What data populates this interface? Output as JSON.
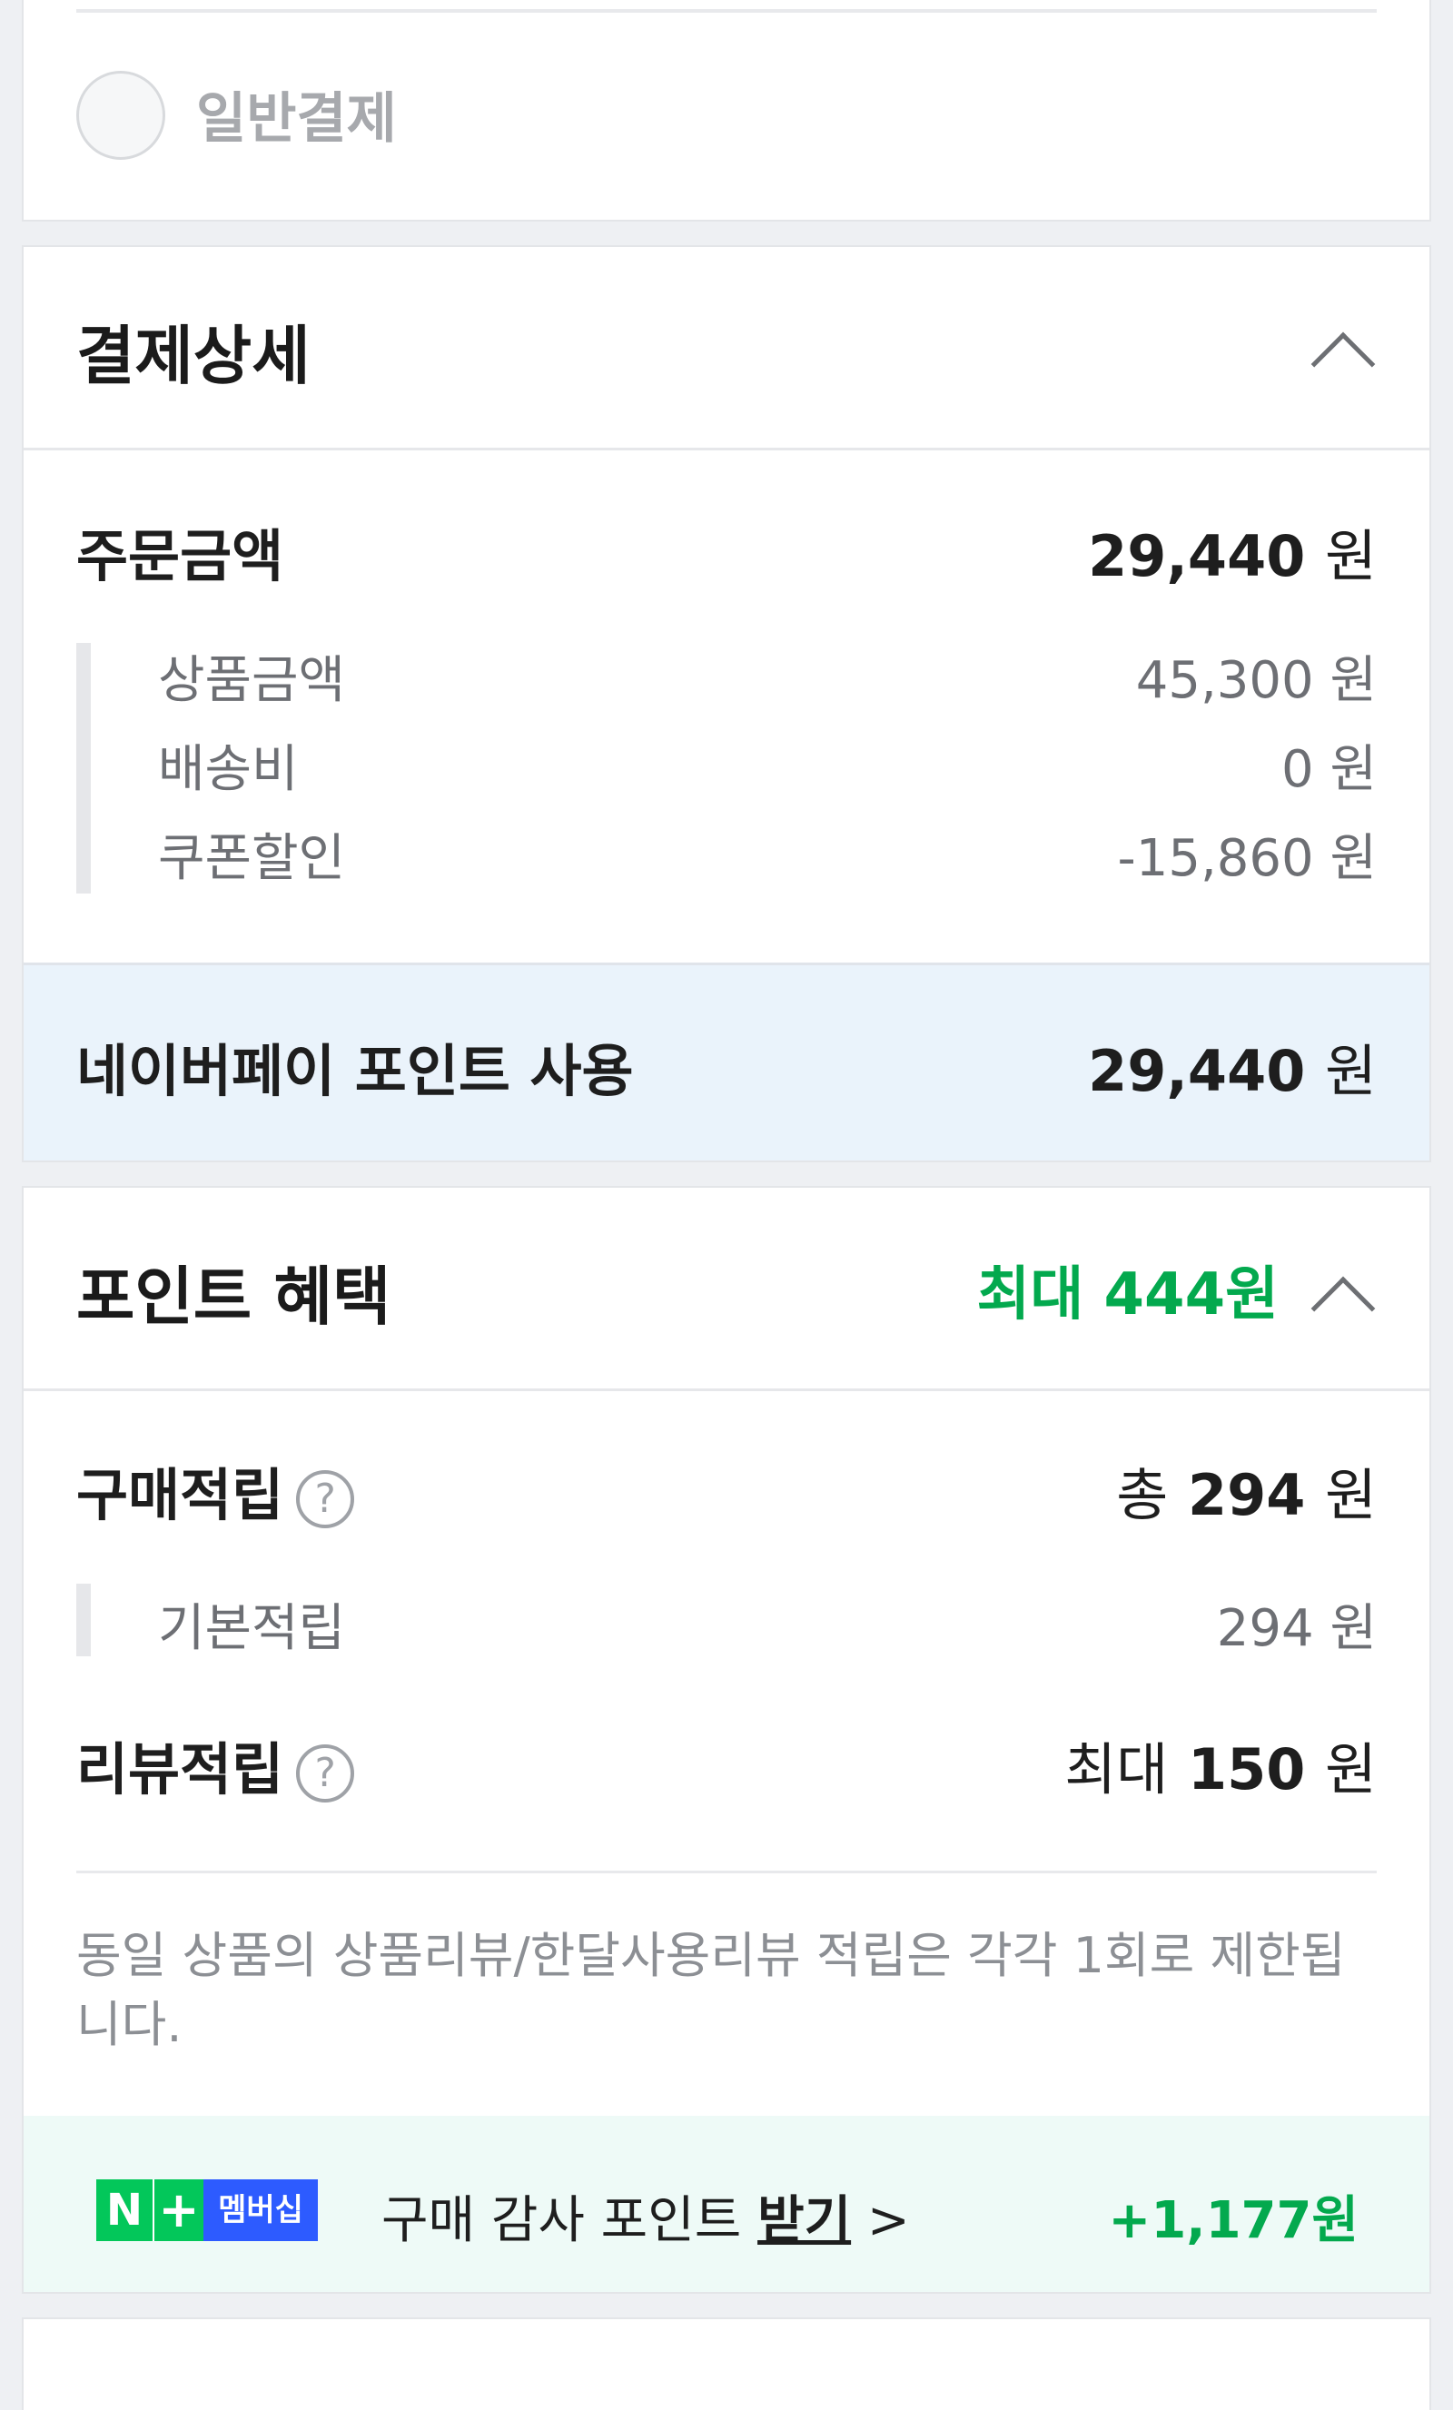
{
  "payment_method": {
    "label": "일반결제"
  },
  "payment_detail": {
    "title": "결제상세",
    "order_amount": {
      "label": "주문금액",
      "value": "29,440",
      "unit": "원"
    },
    "breakdown": [
      {
        "label": "상품금액",
        "value": "45,300",
        "unit": "원"
      },
      {
        "label": "배송비",
        "value": "0",
        "unit": "원"
      },
      {
        "label": "쿠폰할인",
        "value": "-15,860",
        "unit": "원"
      }
    ],
    "point_use": {
      "label": "네이버페이 포인트 사용",
      "value": "29,440",
      "unit": "원"
    }
  },
  "point_benefit": {
    "title": "포인트 혜택",
    "max_label": "최대 444원",
    "purchase": {
      "label": "구매적립",
      "prefix": "총",
      "value": "294",
      "unit": "원"
    },
    "basic": {
      "label": "기본적립",
      "value": "294",
      "unit": "원"
    },
    "review": {
      "label": "리뷰적립",
      "prefix": "최대",
      "value": "150",
      "unit": "원"
    },
    "notice": "동일 상품의 상품리뷰/한달사용리뷰 적립은 각각 1회로 제한됩니다.",
    "membership": {
      "badge_n": "N",
      "badge_plus": "+",
      "badge_label": "멤버십",
      "text": "구매 감사 포인트",
      "link": "받기",
      "arrow": ">",
      "amount": "+1,177원"
    }
  },
  "colors": {
    "green": "#03a94e",
    "highlight_bg": "#eaf3fb",
    "membership_bg": "#eefaf7"
  }
}
